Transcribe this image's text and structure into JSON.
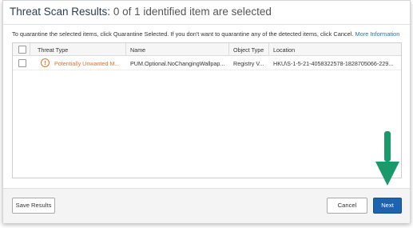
{
  "dialog": {
    "title_bold": "Threat Scan Results:",
    "title_sub": "0 of 1 identified item are selected",
    "instructions": "To quarantine the selected items, click Quarantine Selected. If you don't want to quarantine any of the detected items, click Cancel.",
    "more_info_link": "More Information"
  },
  "table": {
    "columns": [
      "Threat Type",
      "Name",
      "Object Type",
      "Location"
    ],
    "rows": [
      {
        "threat_type": "Potentially Unwanted M...",
        "name": "PUM.Optional.NoChangingWallpap...",
        "object_type": "Registry V...",
        "location": "HKU\\S-1-5-21-4058322578-1828705066-229..."
      }
    ]
  },
  "footer": {
    "save_results_label": "Save Results",
    "cancel_label": "Cancel",
    "next_label": "Next"
  },
  "annotation": {
    "arrow_color": "#1a9a6b"
  },
  "colors": {
    "accent": "#1d63b0",
    "threat": "#e8732c",
    "link": "#1a73c9"
  },
  "icons": {
    "warning": "warning-icon"
  }
}
